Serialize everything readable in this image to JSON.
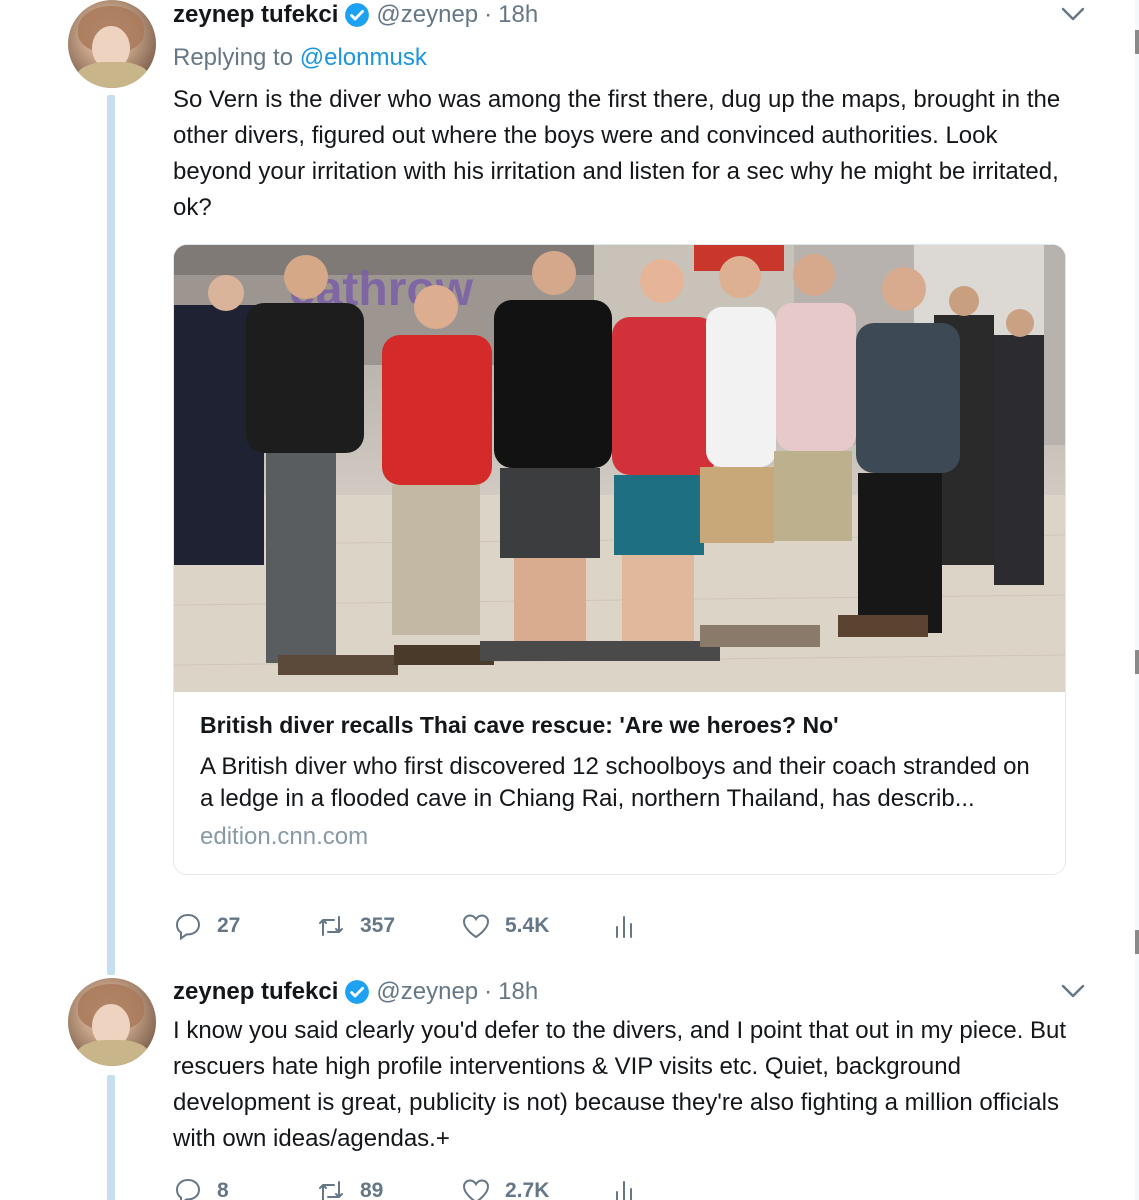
{
  "tweets": [
    {
      "name": "zeynep tufekci",
      "handle": "@zeynep",
      "separator": "·",
      "time": "18h",
      "reply_prefix": "Replying to",
      "reply_to": "@elonmusk",
      "text": "So Vern is the diver who was among the first there, dug up the maps, brought in the other divers, figured out where the boys were and convinced authorities. Look beyond your irritation with his irritation and listen for a sec why he might be irritated, ok?",
      "card": {
        "photo_signage": "eathrow",
        "title": "British diver recalls Thai cave rescue: 'Are we heroes? No'",
        "description": "A British diver who first discovered 12 schoolboys and their coach stranded on a ledge in a flooded cave in Chiang Rai, northern Thailand, has describ...",
        "domain": "edition.cnn.com"
      },
      "replies": "27",
      "retweets": "357",
      "likes": "5.4K"
    },
    {
      "name": "zeynep tufekci",
      "handle": "@zeynep",
      "separator": "·",
      "time": "18h",
      "text": "I know you said clearly you'd defer to the divers, and I point that out in my piece. But rescuers hate high profile interventions & VIP visits etc. Quiet, background development is great, publicity is not) because they're also fighting a million officials with own ideas/agendas.+",
      "replies": "8",
      "retweets": "89",
      "likes": "2.7K"
    }
  ],
  "icons": {
    "verified": "verified-badge-icon",
    "menu": "chevron-down-icon",
    "reply": "reply-icon",
    "retweet": "retweet-icon",
    "like": "heart-icon",
    "analytics": "analytics-icon"
  },
  "colors": {
    "accent": "#1b95e0",
    "muted": "#657786",
    "thread_line": "#c4dff0",
    "card_border": "#e1e8ed"
  }
}
